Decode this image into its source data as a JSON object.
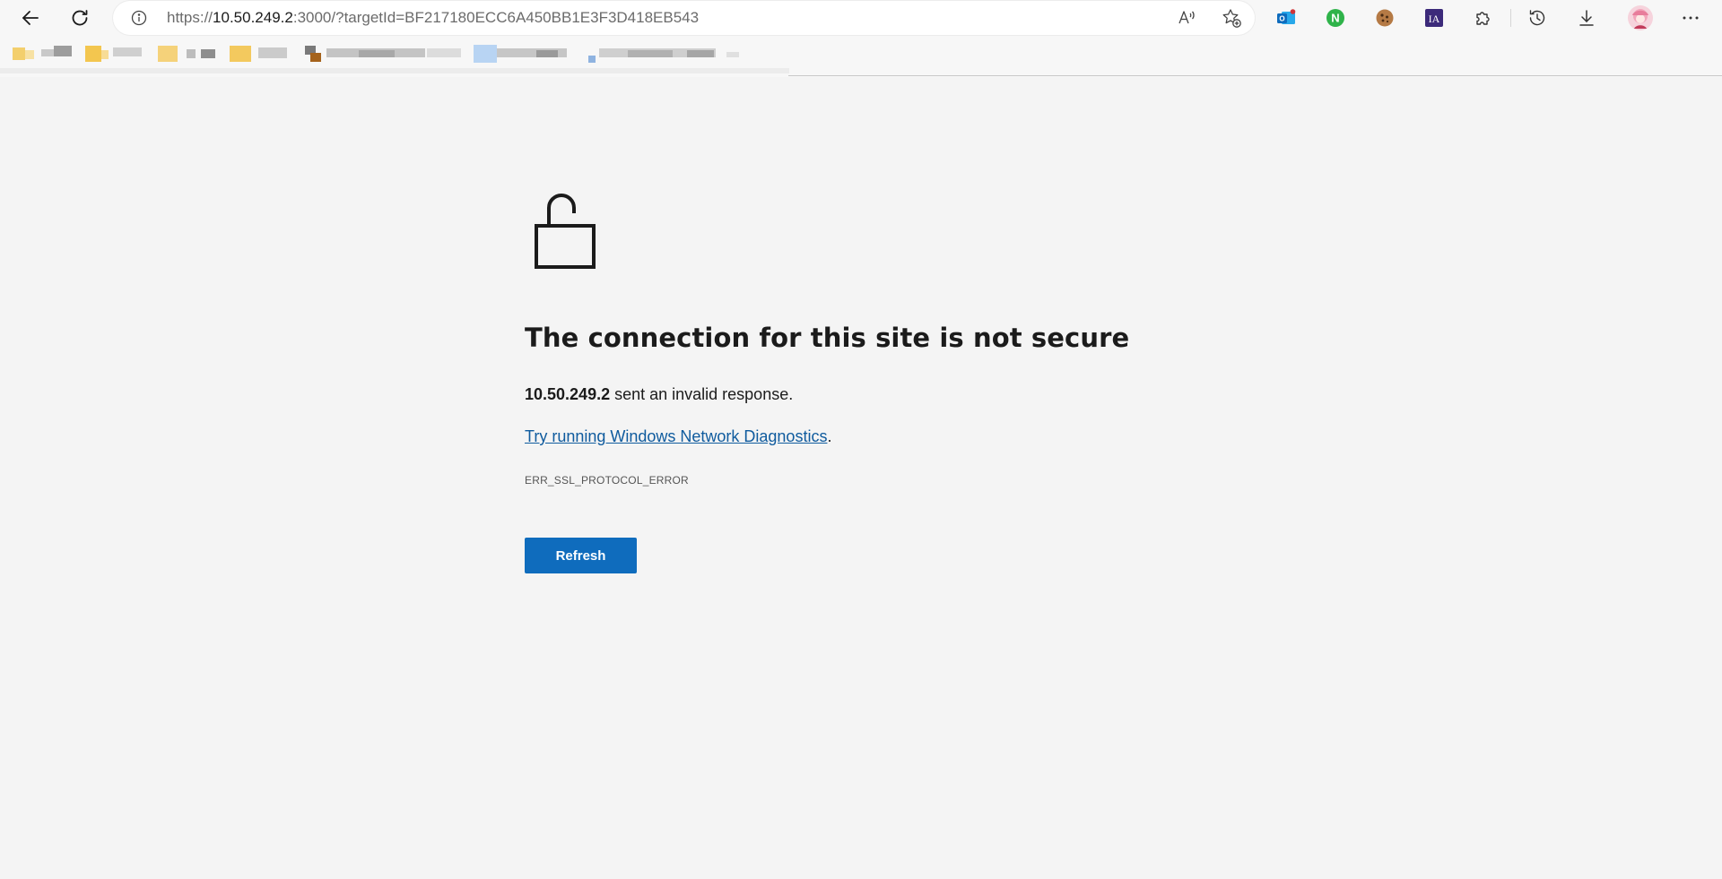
{
  "browser": {
    "url": {
      "scheme": "https://",
      "host": "10.50.249.2",
      "rest": ":3000/?targetId=BF217180ECC6A450BB1E3F3D418EB543"
    },
    "extensions": [
      {
        "name": "outlook-icon",
        "color": "#0f6cbd"
      },
      {
        "name": "n-extension-icon",
        "color": "#2fb34a",
        "letter": "N"
      },
      {
        "name": "cookie-icon",
        "color": "#8a5a2b"
      },
      {
        "name": "ia-extension-icon",
        "color": "#3c2a7a",
        "letter": "IA"
      }
    ]
  },
  "error_page": {
    "title": "The connection for this site is not secure",
    "host": "10.50.249.2",
    "description_suffix": " sent an invalid response.",
    "diagnostics_link": "Try running Windows Network Diagnostics",
    "diagnostics_suffix": ".",
    "error_code": "ERR_SSL_PROTOCOL_ERROR",
    "refresh_label": "Refresh",
    "accent_color": "#0f6cbd"
  }
}
